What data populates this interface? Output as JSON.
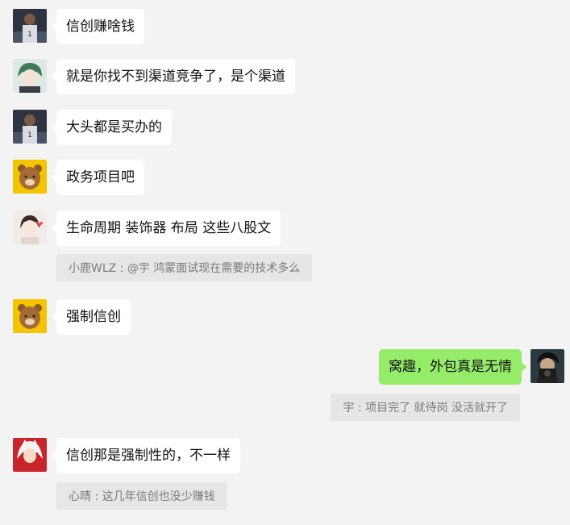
{
  "messages": [
    {
      "text": "信创赚啥钱",
      "avatar": "player-avatar-icon"
    },
    {
      "text": "就是你找不到渠道竞争了，是个渠道",
      "avatar": "anime-boy-avatar-icon"
    },
    {
      "text": "大头都是买办的",
      "avatar": "player-avatar-icon"
    },
    {
      "text": "政务项目吧",
      "avatar": "brown-bear-avatar-icon"
    },
    {
      "text": "生命周期 装饰器 布局 这些八股文",
      "avatar": "girl-heart-avatar-icon",
      "quote": "小鹿WLZ : @宇 鸿蒙面试现在需要的技术多么"
    },
    {
      "text": "强制信创",
      "avatar": "brown-bear-avatar-icon"
    },
    {
      "text": "窝趣，外包真是无情",
      "avatar": "camera-boy-avatar-icon",
      "quote": "宇 : 项目完了 就待岗 没活就开了"
    },
    {
      "text": "信创那是强制性的，不一样",
      "avatar": "inuyasha-avatar-icon",
      "quote": "心晴 : 这几年信创也没少赚钱"
    }
  ],
  "colors": {
    "background": "#f3f3f3",
    "bubble_left": "#ffffff",
    "bubble_right": "#95ec69",
    "quote_bg": "#e6e6e6",
    "quote_text": "#7a7a7a"
  }
}
